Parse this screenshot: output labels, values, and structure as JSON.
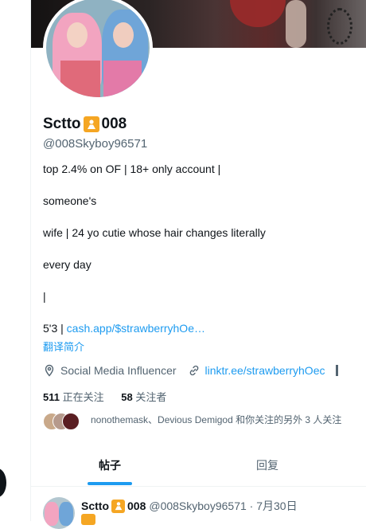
{
  "profile": {
    "name_prefix": "Sctto",
    "name_suffix": "008",
    "badge_icon": "person-emoji-icon",
    "handle": "@008Skyboy96571"
  },
  "bio": {
    "line1": "top 2.4% on OF | 18+ only account |",
    "line2": "someone's",
    "line3": "wife | 24 yo cutie whose hair changes literally",
    "line4": "every day",
    "line5": "|",
    "line6_prefix": "5'3 | ",
    "line6_link": "cash.app/$strawberryhOe…",
    "translate": "翻译简介"
  },
  "meta": {
    "category": "Social Media Influencer",
    "link": "linktr.ee/strawberryhOec"
  },
  "stats": {
    "following_count": "511",
    "following_label": "正在关注",
    "followers_count": "58",
    "followers_label": "关注者"
  },
  "mutual": {
    "text": "nonothemask、Devious Demigod 和你关注的另外 3 人关注"
  },
  "tabs": {
    "posts": "帖子",
    "replies": "回复"
  },
  "post": {
    "name_prefix": "Sctto",
    "name_suffix": "008",
    "meta": "@008Skyboy96571 · 7月30日"
  },
  "colors": {
    "accent": "#1d9bf0",
    "text": "#0f1419",
    "muted": "#536471",
    "badge": "#f5a623"
  }
}
